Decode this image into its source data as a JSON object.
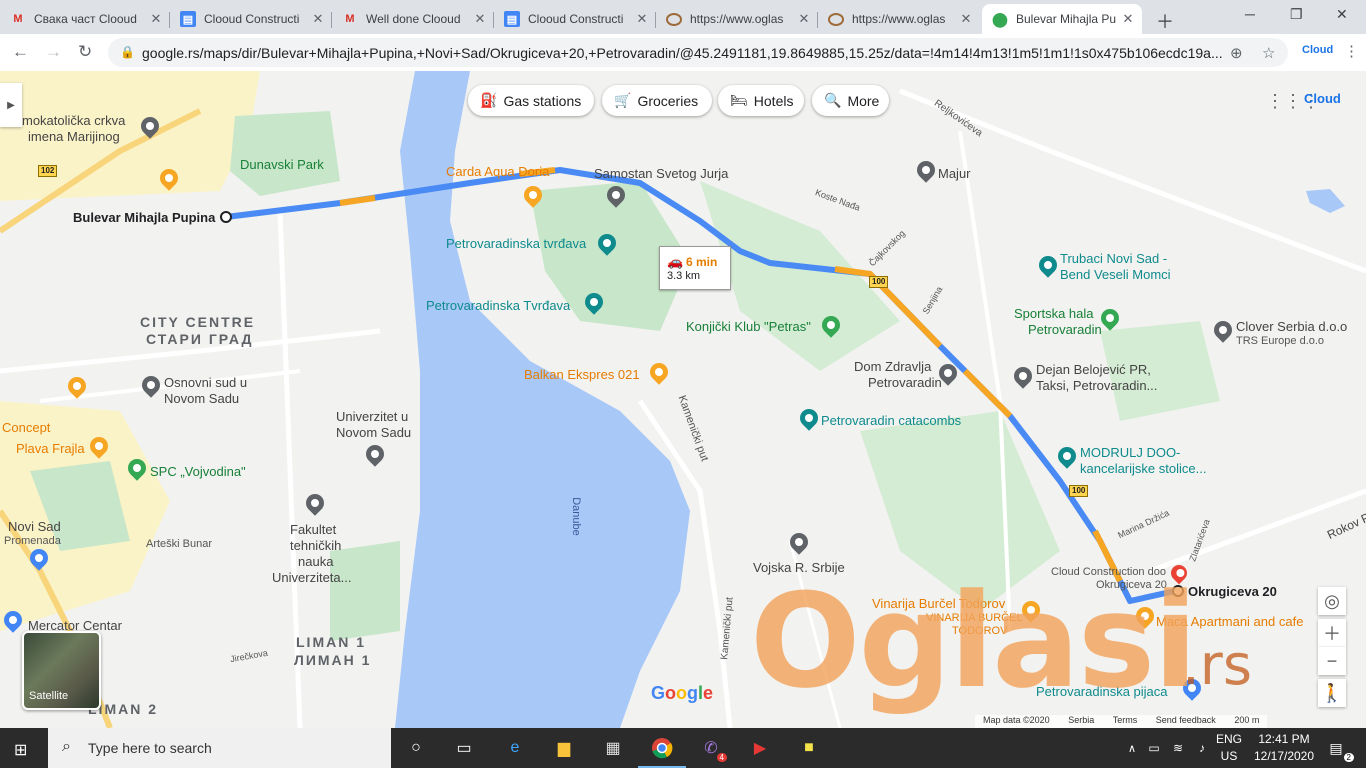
{
  "browser": {
    "tabs": [
      {
        "title": "Свака част Clooud",
        "favicon": "gmail-icon"
      },
      {
        "title": "Clooud Constructi",
        "favicon": "docs-icon"
      },
      {
        "title": "Well done Clooud",
        "favicon": "gmail-icon"
      },
      {
        "title": "Clooud Constructi",
        "favicon": "docs-icon"
      },
      {
        "title": "https://www.oglas",
        "favicon": "oglasi-icon"
      },
      {
        "title": "https://www.oglas",
        "favicon": "oglasi-icon"
      },
      {
        "title": "Bulevar Mihajla Pu",
        "favicon": "maps-icon"
      }
    ],
    "url": "google.rs/maps/dir/Bulevar+Mihajla+Pupina,+Novi+Sad/Okrugiceva+20,+Petrovaradin/@45.2491181,19.8649885,15.25z/data=!4m14!4m13!1m5!1m1!1s0x475b106ecdc19a..."
  },
  "map": {
    "chips": [
      "Gas stations",
      "Groceries",
      "Hotels",
      "More"
    ],
    "route": {
      "time": "6 min",
      "distance": "3.3 km",
      "origin": "Bulevar Mihajla Pupina",
      "destination": "Okrugiceva 20"
    },
    "places": {
      "carda": "Carda Aqua Doria",
      "samostan": "Samostan Svetog Jurja",
      "majur": "Majur",
      "tvrdava1": "Petrovaradinska tvrđava",
      "tvrdava2": "Petrovaradinska Tvrđava",
      "trubaci1": "Trubaci Novi Sad -",
      "trubaci2": "Bend Veseli Momci",
      "sportska1": "Sportska hala",
      "sportska2": "Petrovaradin",
      "clover": "Clover Serbia d.o.o",
      "trs": "TRS Europe d.o.o",
      "konjicki": "Konjički Klub \"Petras\"",
      "dom1": "Dom Zdravlja",
      "dom2": "Petrovaradin",
      "dejan1": "Dejan Belojević PR,",
      "dejan2": "Taksi, Petrovaradin...",
      "balkan": "Balkan Ekspres 021",
      "catacombs": "Petrovaradin catacombs",
      "modrulj1": "MODRULJ DOO-",
      "modrulj2": "kancelarijske stolice...",
      "katolicka1": "mokatolička crkva",
      "katolicka2": "imena Marijinog",
      "dunavski": "Dunavski Park",
      "city1": "CITY CENTRE",
      "city2": "СТАРИ ГРАД",
      "sud1": "Osnovni sud u",
      "sud2": "Novom Sadu",
      "univ1": "Univerzitet u",
      "univ2": "Novom Sadu",
      "concept": "Concept",
      "plava": "Plava Frajla",
      "spc": "SPC „Vojvodina\"",
      "novisad1": "Novi Sad",
      "novisad2": "Promenada",
      "arteski": "Arteški Bunar",
      "fakultet1": "Fakultet",
      "fakultet2": "tehničkih",
      "fakultet3": "nauka",
      "fakultet4": "Univerziteta...",
      "mercator": "Mercator Centar",
      "liman1a": "LIMAN 1",
      "liman1b": "ЛИМАН 1",
      "liman2": "LIMAN 2",
      "vojska": "Vojska R. Srbije",
      "cloudc": "Cloud Construction doo",
      "okr": "Okrugiceva 20",
      "vinarija": "Vinarija Burčel Todorov",
      "vinarija2": "VINARIJA BURČEL",
      "vinarija3": "TODOROV",
      "maca": "Maca Apartmani and cafe",
      "pijaca": "Petrovaradinska pijaca",
      "danube": "Danube",
      "rokov": "Rokov P"
    },
    "streets": {
      "kamenicki": "Kamenički put",
      "reljkoviceva": "Reljkovićeva",
      "koste": "Koste Nađa",
      "cajkovskog": "Čajkovskog",
      "senjina": "Senjina",
      "marina": "Marina Držića",
      "zlatarieva": "Zlatarićeva",
      "jireckova": "Jirečkova",
      "kamenicki2": "Kamenički put",
      "rokovp": "Rokov P"
    },
    "shields": [
      "102",
      "100",
      "100"
    ],
    "satellite_label": "Satellite",
    "footer": [
      "Map data ©2020",
      "Serbia",
      "Terms",
      "Send feedback",
      "200 m"
    ],
    "google_logo": "Google",
    "cloud_label": "Cloud",
    "watermark": "Oglasi",
    "watermark_tld": ".rs"
  },
  "taskbar": {
    "search_placeholder": "Type here to search",
    "lang1": "ENG",
    "lang2": "US",
    "time": "12:41 PM",
    "date": "12/17/2020",
    "viber_badge": "4",
    "notif_badge": "2"
  },
  "colors": {
    "route": "#4a8af4",
    "traffic": "#f6a623",
    "river": "#a8c8f8",
    "park": "#c5e8c5"
  }
}
